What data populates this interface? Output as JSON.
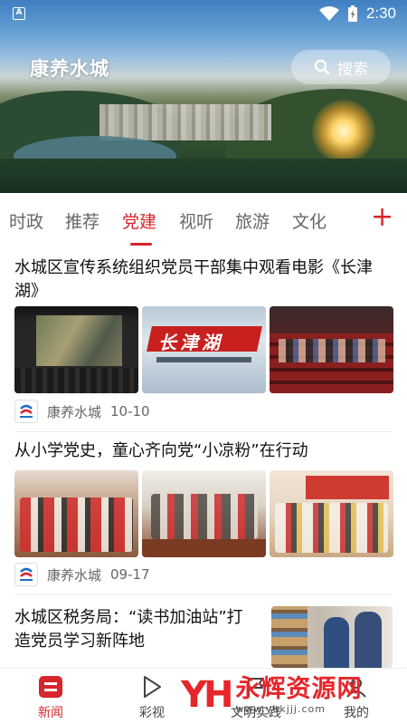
{
  "status_bar": {
    "app_indicator": "A",
    "time": "2:30"
  },
  "header": {
    "title": "康养水城",
    "search_label": "搜索"
  },
  "tabs": [
    {
      "label": "时政"
    },
    {
      "label": "推荐"
    },
    {
      "label": "党建"
    },
    {
      "label": "视听"
    },
    {
      "label": "旅游"
    },
    {
      "label": "文化"
    }
  ],
  "add_tab_label": "+",
  "news": [
    {
      "title": "水城区宣传系统组织党员干部集中观看电影《长津湖》",
      "source": "康养水城",
      "date": "10-10",
      "poster_text": "长津湖"
    },
    {
      "title": "从小学党史，童心齐向党“小凉粉”在行动",
      "source": "康养水城",
      "date": "09-17"
    },
    {
      "title": "水城区税务局：“读书加油站”打造党员学习新阵地"
    }
  ],
  "bottom_nav": [
    {
      "label": "新闻"
    },
    {
      "label": "彩视"
    },
    {
      "label": "文明实践"
    },
    {
      "label": "我的"
    }
  ],
  "watermark": {
    "logo": "YH",
    "name": "永辉资源网",
    "url": "www.yhkjjj.com"
  },
  "colors": {
    "accent": "#d6262b",
    "text": "#222222",
    "muted": "#666666"
  }
}
